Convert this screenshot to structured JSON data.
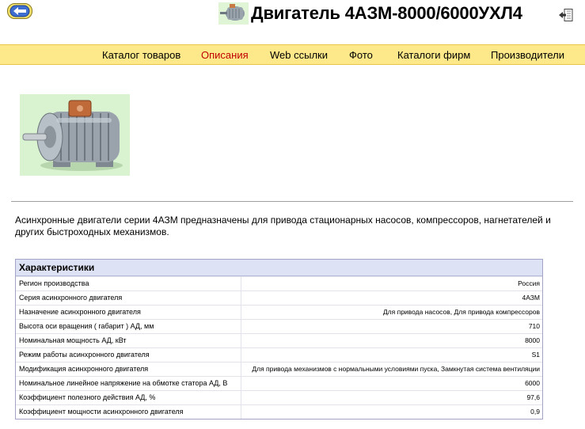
{
  "header": {
    "title": "Двигатель 4АЗМ-8000/6000УХЛ4",
    "back_icon": "arrow-left-icon",
    "exit_icon": "exit-icon"
  },
  "nav": {
    "items": [
      {
        "label": "Каталог товаров",
        "active": false
      },
      {
        "label": "Описания",
        "active": true
      },
      {
        "label": "Web ссылки",
        "active": false
      },
      {
        "label": "Фото",
        "active": false
      },
      {
        "label": "Каталоги фирм",
        "active": false
      },
      {
        "label": "Производители",
        "active": false
      }
    ],
    "bg_color": "#fde98a",
    "active_color": "#c00000"
  },
  "description": "Асинхронные двигатели серии 4АЗМ предназначены для привода стационарных насосов, компрессоров, нагнетателей и других быстроходных механизмов.",
  "specs": {
    "header": "Характеристики",
    "rows": [
      {
        "label": "Регион производства",
        "value": "Россия"
      },
      {
        "label": "Серия асинхронного двигателя",
        "value": "4АЗМ"
      },
      {
        "label": "Назначение асинхронного двигателя",
        "value": "Для привода насосов, Для привода компрессоров"
      },
      {
        "label": "Высота оси вращения ( габарит ) АД, мм",
        "value": "710"
      },
      {
        "label": "Номинальная мощность АД, кВт",
        "value": "8000"
      },
      {
        "label": "Режим работы асинхронного двигателя",
        "value": "S1"
      },
      {
        "label": "Модификация асинхронного двигателя",
        "value": "Для привода механизмов с нормальными условиями пуска, Замкнутая система вентиляции"
      },
      {
        "label": "Номинальное линейное напряжение на обмотке статора АД, В",
        "value": "6000"
      },
      {
        "label": "Коэффициент полезного действия АД, %",
        "value": "97,6"
      },
      {
        "label": "Коэффициент мощности асинхронного двигателя",
        "value": "0,9"
      }
    ]
  }
}
